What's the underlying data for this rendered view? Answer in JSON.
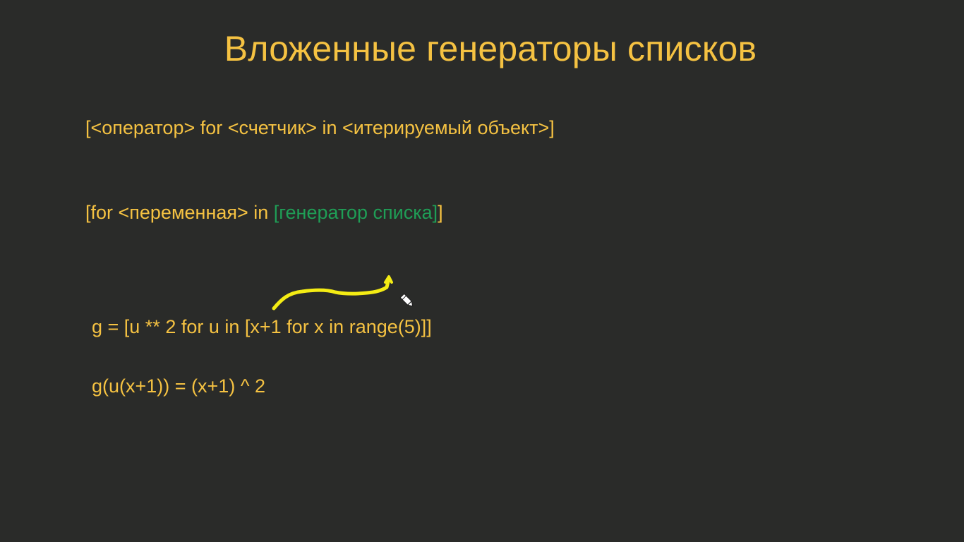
{
  "slide": {
    "title": "Вложенные генераторы списков",
    "syntax_general": "[<оператор> for <счетчик> in <итерируемый объект>]",
    "syntax_nested": {
      "prefix": "[for <переменная> in ",
      "inner": "[генератор списка]",
      "suffix": "]"
    },
    "code_example": "g = [u ** 2 for u in [x+1 for x in range(5)]]",
    "math_explanation": "g(u(x+1)) = (x+1) ^ 2"
  },
  "colors": {
    "background": "#2a2b29",
    "text": "#f5c242",
    "highlight": "#1f9e56",
    "ink": "#f4ec14"
  },
  "icons": {
    "cursor": "pen-cursor-icon"
  }
}
